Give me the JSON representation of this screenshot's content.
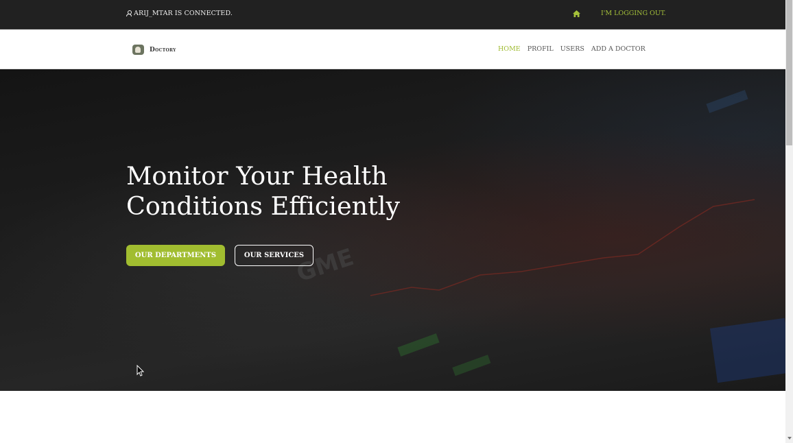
{
  "topbar": {
    "status_text": "ARIJ_MTAR IS CONNECTED.",
    "user_icon": "user-icon",
    "home_icon": "home-icon",
    "logout_label": "I'M LOGGING OUT."
  },
  "brand": {
    "logo_icon": "doctor-logo",
    "name": "Doctory"
  },
  "nav": {
    "items": [
      {
        "label": "HOME",
        "active": true
      },
      {
        "label": "PROFIL",
        "active": false
      },
      {
        "label": "USERS",
        "active": false
      },
      {
        "label": "ADD A DOCTOR",
        "active": false
      }
    ]
  },
  "hero": {
    "title": "Monitor Your Health Conditions Efficiently",
    "primary_button": "OUR DEPARTMENTS",
    "secondary_button": "OUR SERVICES"
  },
  "colors": {
    "accent": "#a1bd30",
    "topbar_bg": "#212121",
    "hero_bg": "#1c1c1c"
  }
}
